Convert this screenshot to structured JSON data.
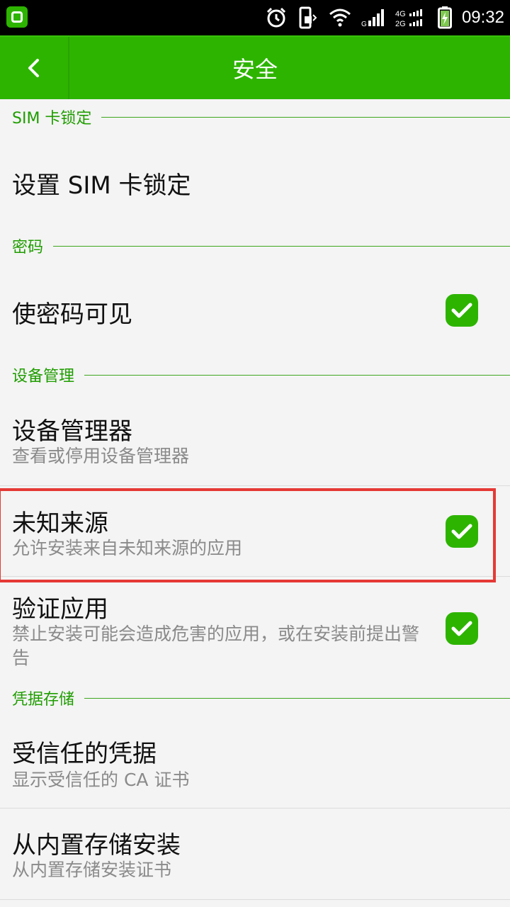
{
  "status_bar": {
    "time": "09:32",
    "icons": [
      "app-shield-icon",
      "alarm-icon",
      "vibrate-icon",
      "wifi-icon",
      "signal-g-icon",
      "signal-4g-2g-icon",
      "battery-charging-icon"
    ],
    "network_labels": {
      "g": "G",
      "net1": "4G",
      "net2": "2G"
    }
  },
  "app_bar": {
    "title": "安全",
    "background_color": "#2db400"
  },
  "sections": {
    "sim": {
      "header": "SIM 卡锁定",
      "items": [
        {
          "title": "设置 SIM 卡锁定"
        }
      ]
    },
    "password": {
      "header": "密码",
      "items": [
        {
          "title": "使密码可见",
          "checked": true
        }
      ]
    },
    "device_admin": {
      "header": "设备管理",
      "items": [
        {
          "title": "设备管理器",
          "subtitle": "查看或停用设备管理器"
        },
        {
          "title": "未知来源",
          "subtitle": "允许安装来自未知来源的应用",
          "checked": true
        },
        {
          "title": "验证应用",
          "subtitle": "禁止安装可能会造成危害的应用，或在安装前提出警告",
          "checked": true
        }
      ]
    },
    "credentials": {
      "header": "凭据存储",
      "items": [
        {
          "title": "受信任的凭据",
          "subtitle": "显示受信任的 CA 证书"
        },
        {
          "title": "从内置存储安装",
          "subtitle": "从内置存储安装证书"
        }
      ]
    }
  },
  "accent_color": "#2db400",
  "highlight_color": "#e53935"
}
